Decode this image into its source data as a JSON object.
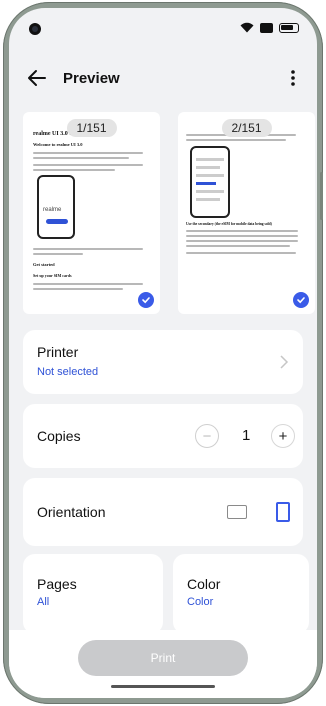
{
  "header": {
    "title": "Preview"
  },
  "previews": [
    {
      "badge": "1/151",
      "heading": "realme UI 3.0 user manual",
      "subheading": "Welcome to realme UI 3.0",
      "phone_label": "realme",
      "section": "Get started",
      "subsection": "Set up your SIM cards"
    },
    {
      "badge": "2/151",
      "section": "Use the secondary (the eSIM for mobile data being sold)"
    }
  ],
  "printer": {
    "label": "Printer",
    "value": "Not selected"
  },
  "copies": {
    "label": "Copies",
    "value": "1",
    "minus": "−",
    "plus": "+"
  },
  "orientation": {
    "label": "Orientation"
  },
  "pages": {
    "label": "Pages",
    "value": "All"
  },
  "color": {
    "label": "Color",
    "value": "Color"
  },
  "action": {
    "print_label": "Print"
  },
  "colors": {
    "accent": "#3a5be8",
    "link": "#2f52d6",
    "background": "#f1f2f4"
  }
}
